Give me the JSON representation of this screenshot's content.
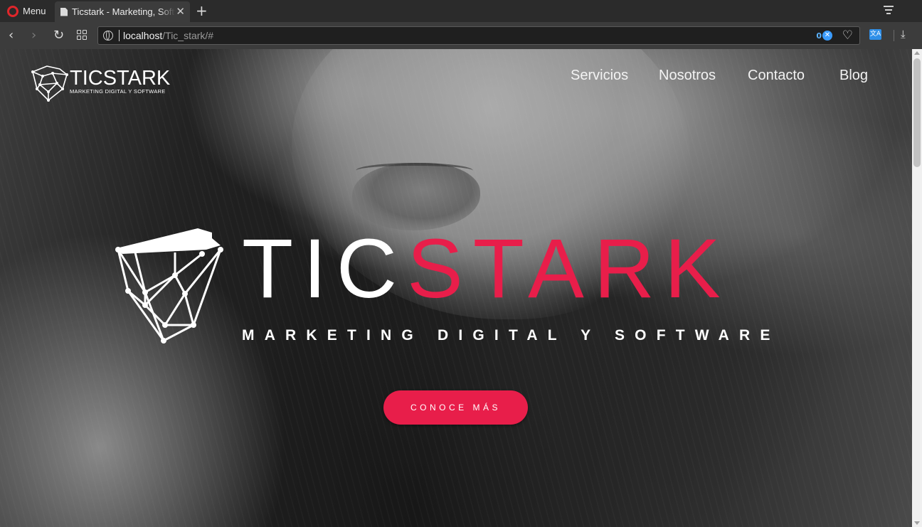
{
  "browser": {
    "menu_label": "Menu",
    "tab_title": "Ticstark - Marketing, Software",
    "tab_close": "✕",
    "new_tab": "+",
    "url_host": "localhost",
    "url_path": "/Tic_stark/#",
    "adblock_count": "0",
    "icons": [
      "opera-logo-icon",
      "document-icon",
      "close-icon",
      "plus-icon",
      "tab-menu-icon",
      "back-icon",
      "forward-icon",
      "reload-icon",
      "speed-dial-icon",
      "globe-icon",
      "adblock-icon",
      "heart-icon",
      "translate-icon",
      "download-icon"
    ]
  },
  "site": {
    "logo_word": "TICSTARK",
    "logo_tagline": "MARKETING DIGITAL Y SOFTWARE",
    "nav": [
      "Servicios",
      "Nosotros",
      "Contacto",
      "Blog"
    ],
    "hero": {
      "title_part1": "TIC",
      "title_part2": "STARK",
      "subtitle": "MARKETING DIGITAL Y SOFTWARE",
      "cta": "CONOCE MÁS"
    },
    "colors": {
      "accent": "#e81e4a",
      "text": "#ffffff"
    }
  }
}
